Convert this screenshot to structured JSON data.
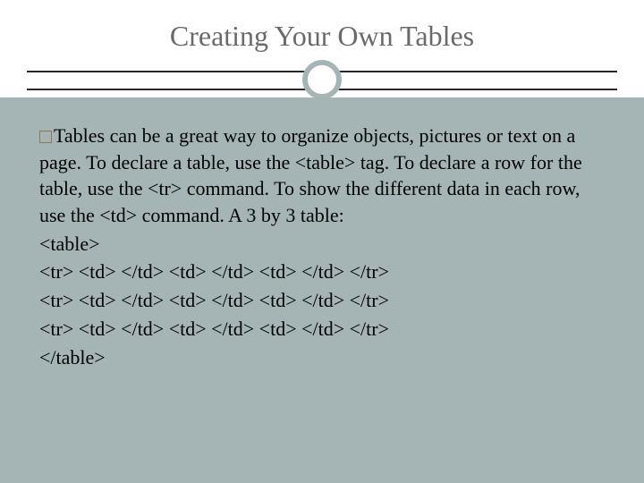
{
  "slide": {
    "title": "Creating Your Own Tables",
    "paragraph": "Tables can be a great way to organize objects, pictures or text on a page.  To declare a table, use the <table> tag.  To declare a row for the table, use the <tr> command.  To show the different data in each row, use the <td> command.  A 3 by 3 table:",
    "code": [
      "<table>",
      "<tr> <td> </td> <td> </td> <td> </td> </tr>",
      "<tr> <td> </td> <td> </td> <td> </td> </tr>",
      "<tr> <td> </td> <td> </td> <td> </td> </tr>",
      "</table>"
    ]
  }
}
